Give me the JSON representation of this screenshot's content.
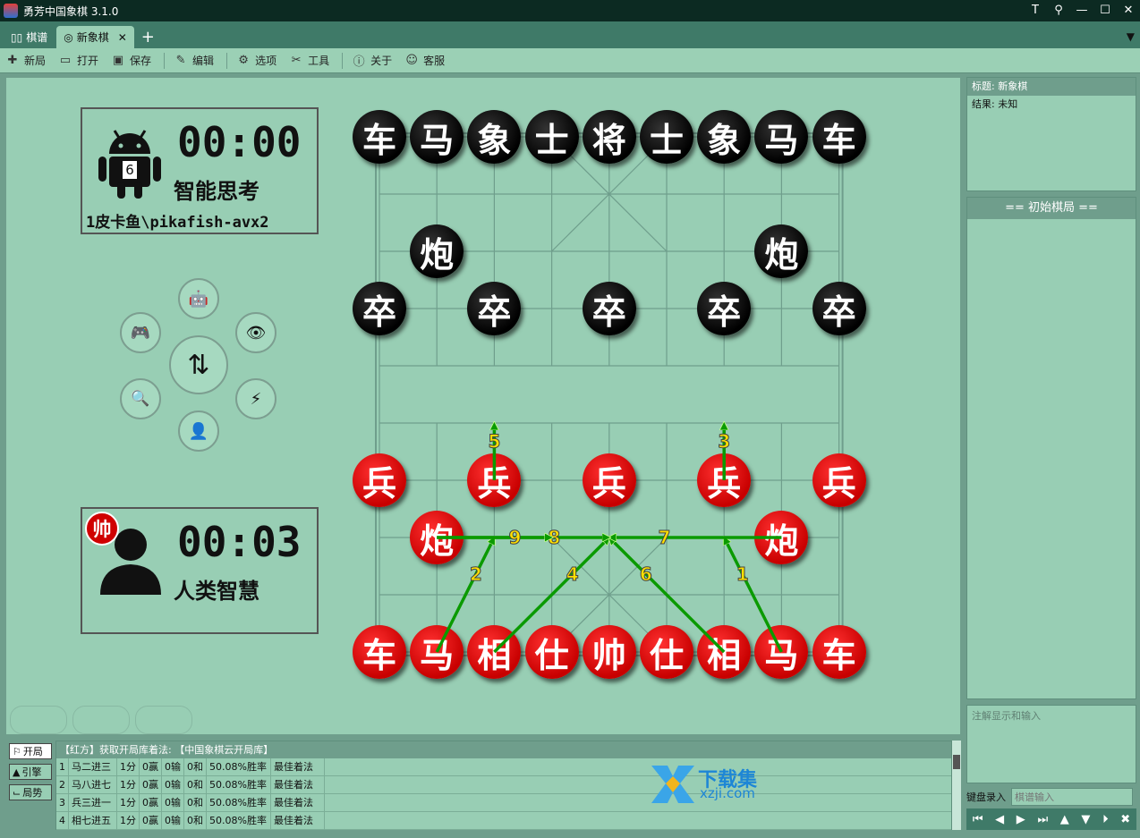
{
  "window": {
    "title": "勇芳中国象棋 3.1.0",
    "controls": [
      "T",
      "⚲",
      "—",
      "☐",
      "✕"
    ]
  },
  "tabs": [
    {
      "label": "棋谱",
      "icon": "book-icon",
      "active": false
    },
    {
      "label": "新象棋",
      "icon": "target-icon",
      "active": true,
      "close": "✕"
    }
  ],
  "tab_add": "+",
  "tab_menu": "▼",
  "toolbar": [
    {
      "label": "新局",
      "icon": "new-game-icon",
      "glyph": "✚"
    },
    {
      "label": "打开",
      "icon": "folder-icon",
      "glyph": "▭"
    },
    {
      "label": "保存",
      "icon": "save-icon",
      "glyph": "▣"
    },
    {
      "label": "编辑",
      "icon": "edit-icon",
      "glyph": "✎"
    },
    {
      "label": "选项",
      "icon": "gear-icon",
      "glyph": "⚙"
    },
    {
      "label": "工具",
      "icon": "tools-icon",
      "glyph": "✂"
    },
    {
      "label": "关于",
      "icon": "info-icon",
      "glyph": "ⓘ"
    },
    {
      "label": "客服",
      "icon": "chat-icon",
      "glyph": "☺"
    }
  ],
  "top_player": {
    "clock": "00:00",
    "status": "智能思考",
    "engine": "1皮卡鱼\\pikafish-avx2",
    "level": "6",
    "icon": "android-icon"
  },
  "bottom_player": {
    "clock": "00:03",
    "status": "人类智慧",
    "side_badge": "帅",
    "icon": "user-icon"
  },
  "control_buttons": [
    {
      "name": "android-icon",
      "glyph": "🤖"
    },
    {
      "name": "gamepad-icon",
      "glyph": "🎮"
    },
    {
      "name": "eye-icon",
      "glyph": "👁"
    },
    {
      "name": "swap-icon",
      "glyph": "⇅"
    },
    {
      "name": "search-icon",
      "glyph": "🔍"
    },
    {
      "name": "lightning-icon",
      "glyph": "⚡"
    },
    {
      "name": "user-icon",
      "glyph": "👤"
    }
  ],
  "board": {
    "black_pieces": [
      {
        "c": "车",
        "f": 0,
        "r": 0
      },
      {
        "c": "马",
        "f": 1,
        "r": 0
      },
      {
        "c": "象",
        "f": 2,
        "r": 0
      },
      {
        "c": "士",
        "f": 3,
        "r": 0
      },
      {
        "c": "将",
        "f": 4,
        "r": 0
      },
      {
        "c": "士",
        "f": 5,
        "r": 0
      },
      {
        "c": "象",
        "f": 6,
        "r": 0
      },
      {
        "c": "马",
        "f": 7,
        "r": 0
      },
      {
        "c": "车",
        "f": 8,
        "r": 0
      },
      {
        "c": "炮",
        "f": 1,
        "r": 2
      },
      {
        "c": "炮",
        "f": 7,
        "r": 2
      },
      {
        "c": "卒",
        "f": 0,
        "r": 3
      },
      {
        "c": "卒",
        "f": 2,
        "r": 3
      },
      {
        "c": "卒",
        "f": 4,
        "r": 3
      },
      {
        "c": "卒",
        "f": 6,
        "r": 3
      },
      {
        "c": "卒",
        "f": 8,
        "r": 3
      }
    ],
    "red_pieces": [
      {
        "c": "兵",
        "f": 0,
        "r": 6
      },
      {
        "c": "兵",
        "f": 2,
        "r": 6
      },
      {
        "c": "兵",
        "f": 4,
        "r": 6
      },
      {
        "c": "兵",
        "f": 6,
        "r": 6
      },
      {
        "c": "兵",
        "f": 8,
        "r": 6
      },
      {
        "c": "炮",
        "f": 1,
        "r": 7
      },
      {
        "c": "炮",
        "f": 7,
        "r": 7
      },
      {
        "c": "车",
        "f": 0,
        "r": 9
      },
      {
        "c": "马",
        "f": 1,
        "r": 9
      },
      {
        "c": "相",
        "f": 2,
        "r": 9
      },
      {
        "c": "仕",
        "f": 3,
        "r": 9
      },
      {
        "c": "帅",
        "f": 4,
        "r": 9
      },
      {
        "c": "仕",
        "f": 5,
        "r": 9
      },
      {
        "c": "相",
        "f": 6,
        "r": 9
      },
      {
        "c": "马",
        "f": 7,
        "r": 9
      },
      {
        "c": "车",
        "f": 8,
        "r": 9
      }
    ],
    "hint_arrows": [
      {
        "n": "1",
        "from": [
          7,
          9
        ],
        "to": [
          6,
          7
        ]
      },
      {
        "n": "2",
        "from": [
          1,
          9
        ],
        "to": [
          2,
          7
        ]
      },
      {
        "n": "3",
        "from": [
          6,
          6
        ],
        "to": [
          6,
          5
        ]
      },
      {
        "n": "4",
        "from": [
          2,
          9
        ],
        "to": [
          4,
          7
        ]
      },
      {
        "n": "5",
        "from": [
          2,
          6
        ],
        "to": [
          2,
          5
        ]
      },
      {
        "n": "6",
        "from": [
          6,
          9
        ],
        "to": [
          4,
          7
        ]
      },
      {
        "n": "7",
        "from": [
          7,
          7
        ],
        "to": [
          4,
          7
        ]
      },
      {
        "n": "8",
        "from": [
          1,
          7
        ],
        "to": [
          4,
          7
        ]
      },
      {
        "n": "9",
        "from": [
          1,
          7
        ],
        "to": [
          3,
          7
        ]
      }
    ]
  },
  "game_info": [
    {
      "label": "标题: 新象棋",
      "selected": true
    },
    {
      "label": "结果: 未知",
      "selected": false
    }
  ],
  "move_list_header": "==  初始棋局  ==",
  "comment_placeholder": "注解显示和输入",
  "keyboard": {
    "label": "键盘录入",
    "placeholder": "棋谱输入"
  },
  "nav_buttons": [
    {
      "name": "first-move-icon",
      "glyph": "⏮"
    },
    {
      "name": "prev-move-icon",
      "glyph": "◀"
    },
    {
      "name": "next-move-icon",
      "glyph": "▶"
    },
    {
      "name": "last-move-icon",
      "glyph": "⏭"
    },
    {
      "name": "up-icon",
      "glyph": "▲"
    },
    {
      "name": "down-icon",
      "glyph": "▼"
    },
    {
      "name": "play-icon",
      "glyph": "⏵"
    },
    {
      "name": "close-icon",
      "glyph": "✖"
    }
  ],
  "bottom_tabs": [
    {
      "label": "开局",
      "icon": "flag-icon",
      "glyph": "⚐",
      "active": true
    },
    {
      "label": "引擎",
      "icon": "android-icon",
      "glyph": "▲",
      "active": false
    },
    {
      "label": "局势",
      "icon": "chart-icon",
      "glyph": "⌙",
      "active": false
    }
  ],
  "opening_book": {
    "header": "【红方】获取开局库着法: 【中国象棋云开局库】",
    "rows": [
      [
        "1",
        "马二进三",
        "1分",
        "0赢",
        "0输",
        "0和",
        "50.08%胜率",
        "最佳着法"
      ],
      [
        "2",
        "马八进七",
        "1分",
        "0赢",
        "0输",
        "0和",
        "50.08%胜率",
        "最佳着法"
      ],
      [
        "3",
        "兵三进一",
        "1分",
        "0赢",
        "0输",
        "0和",
        "50.08%胜率",
        "最佳着法"
      ],
      [
        "4",
        "相七进五",
        "1分",
        "0赢",
        "0输",
        "0和",
        "50.08%胜率",
        "最佳着法"
      ]
    ]
  },
  "watermark": {
    "line1": "下载集",
    "line2": "xzji.com"
  },
  "colors": {
    "bg": "#98ceb4",
    "dark": "#6f9e8c",
    "red": "#d00000",
    "arrow": "#0a9a00",
    "label": "#ffe000"
  }
}
